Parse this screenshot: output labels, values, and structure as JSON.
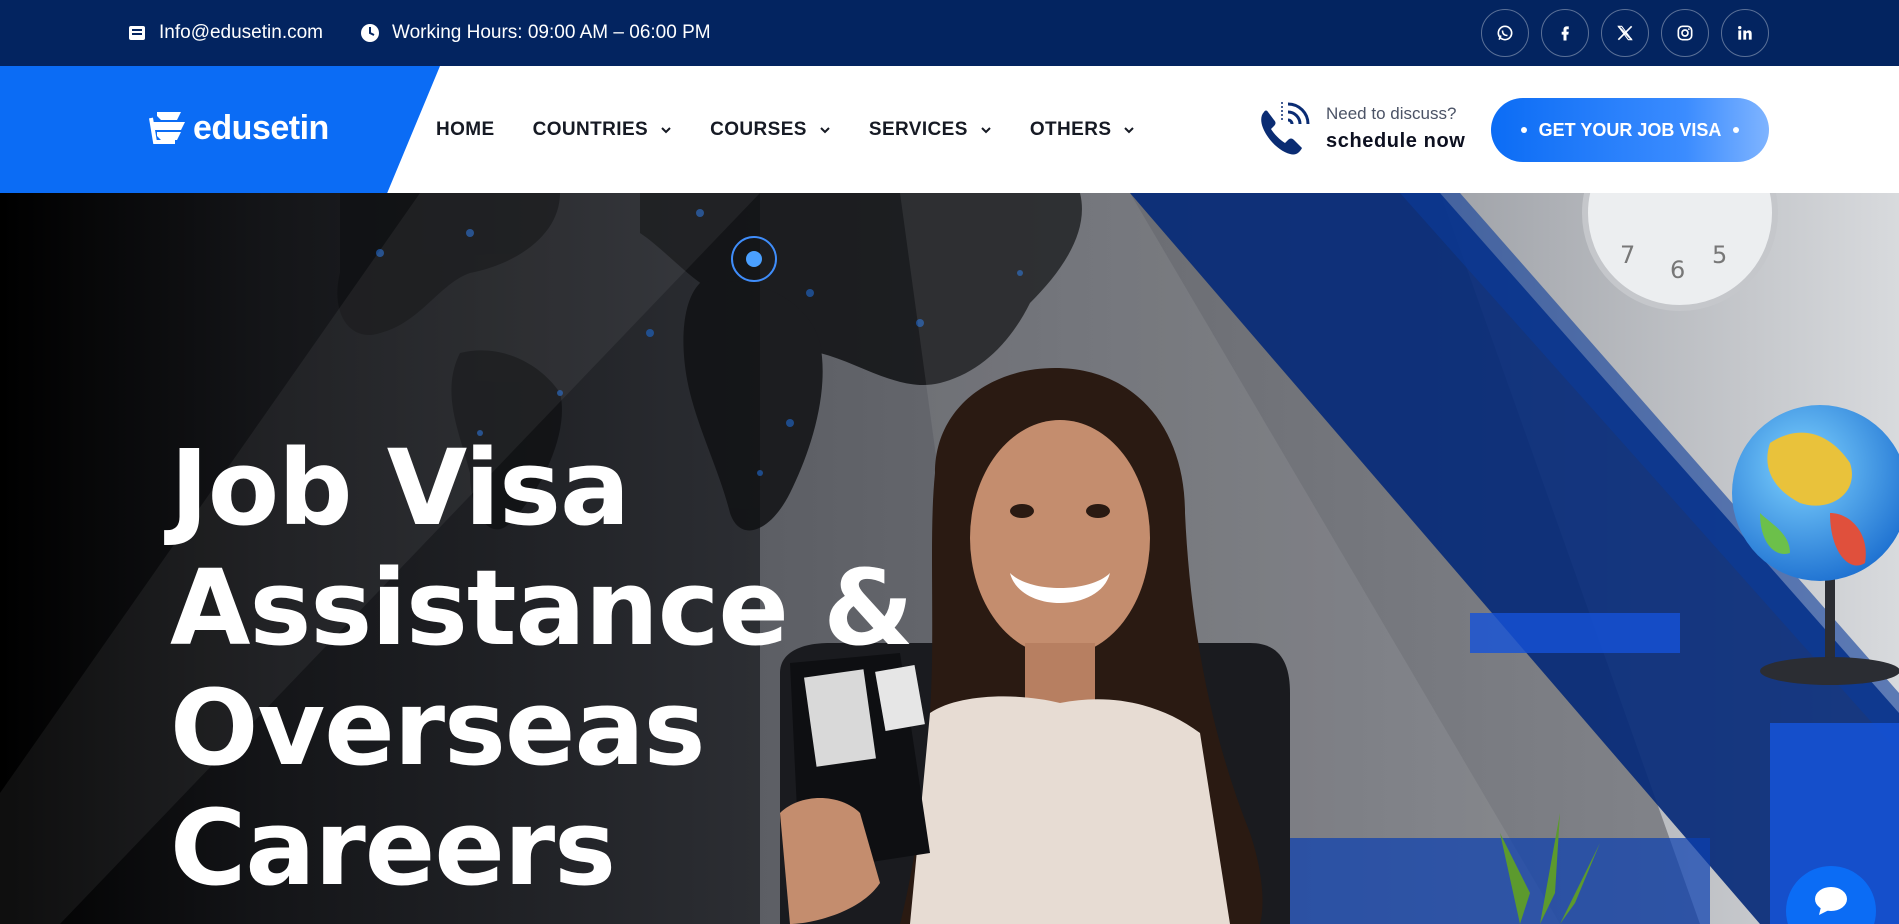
{
  "topbar": {
    "email": "Info@edusetin.com",
    "hours": "Working Hours: 09:00 AM – 06:00 PM",
    "socials": [
      {
        "icon": "whatsapp-icon"
      },
      {
        "icon": "facebook-icon"
      },
      {
        "icon": "x-twitter-icon"
      },
      {
        "icon": "instagram-icon"
      },
      {
        "icon": "linkedin-icon"
      }
    ]
  },
  "header": {
    "logo_text": "edusetin",
    "nav": [
      {
        "label": "HOME",
        "dropdown": false
      },
      {
        "label": "COUNTRIES",
        "dropdown": true
      },
      {
        "label": "COURSES",
        "dropdown": true
      },
      {
        "label": "SERVICES",
        "dropdown": true
      },
      {
        "label": "OTHERS",
        "dropdown": true
      }
    ],
    "discuss_small": "Need to discuss?",
    "discuss_big": "schedule now",
    "cta_label": "GET YOUR JOB VISA"
  },
  "hero": {
    "title_lines": [
      "Job Visa",
      "Assistance &",
      "Overseas",
      "Careers"
    ]
  },
  "colors": {
    "topbar_bg": "#032460",
    "brand_blue": "#0b6cf5",
    "deep_blue": "#062a78",
    "text_dark": "#161a24"
  }
}
